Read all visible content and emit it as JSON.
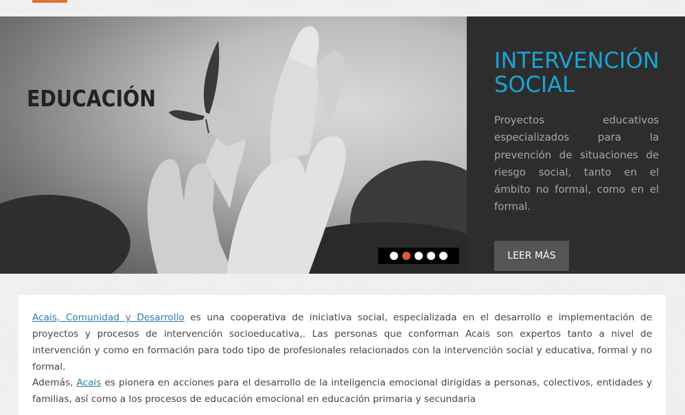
{
  "slider": {
    "image_word": "EDUCACIÓN",
    "title": "INTERVENCIÓN SOCIAL",
    "description": "Proyectos educativos especializados para la prevención de situaciones de riesgo social, tanto en el ámbito no formal, como en el formal.",
    "button_label": "LEER MÁS",
    "dots": 5,
    "active_dot": 2
  },
  "content": {
    "p1_link": "Acais, Comunidad y Desarrollo",
    "p1_text": " es una cooperativa de iniciativa social, especializada en el desarrollo e implementación de proyectos y procesos de intervención socioeducativa,. Las personas que conforman Acais son expertos tanto a nivel de intervención y como en formación para todo tipo de profesionales relacionados con la intervención social y educativa, formal y no formal.",
    "p2_prefix": "Además, ",
    "p2_link": "Acais",
    "p2_text": " es pionera en acciones para el desarrollo de la inteligencia emocional dirigidas a personas, colectivos, entidades y familias, así como a los procesos de educación emocional en educación primaria y secundaria"
  },
  "colors": {
    "accent": "#e0702c",
    "title_blue": "#1aa3d6",
    "panel_bg": "#2d2d2d",
    "active_dot": "#d4622a",
    "link": "#2a7fb0"
  }
}
